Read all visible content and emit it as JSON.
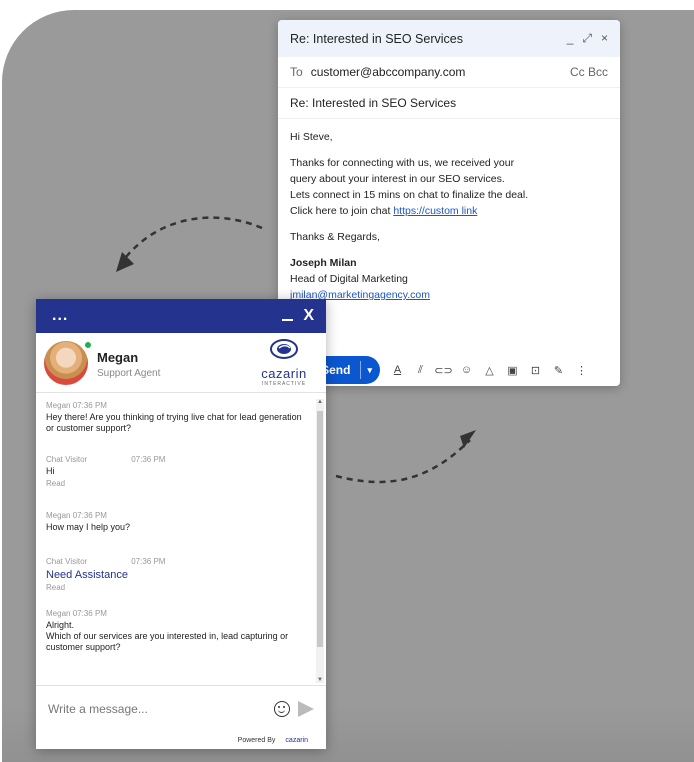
{
  "email": {
    "header_title": "Re: Interested in SEO Services",
    "window_controls": [
      "_",
      "⤢",
      "×"
    ],
    "to_label": "To",
    "to_value": "customer@abccompany.com",
    "cc_bcc": "Cc Bcc",
    "subject": "Re: Interested in SEO Services",
    "greeting": "Hi Steve,",
    "body_lines": [
      "Thanks for connecting with us, we received your",
      "query about your interest in our SEO services.",
      "Lets connect in 15 mins on chat to finalize the deal.",
      "Click here to join chat"
    ],
    "link_text": "https://custom link",
    "closing": "Thanks & Regards,",
    "signature_name": "Joseph Milan",
    "signature_title": "Head of Digital Marketing",
    "signature_email": "jmilan@marketingagency.com",
    "send_label": "Send",
    "toolbar_icons": [
      "format-icon",
      "attach-icon",
      "link-icon",
      "emoji-icon",
      "drive-icon",
      "photo-icon",
      "lock-icon",
      "pen-icon",
      "more-icon"
    ]
  },
  "chat": {
    "menu_dots": "...",
    "close_label": "X",
    "agent_name": "Megan",
    "agent_role": "Support Agent",
    "brand_name": "cazarin",
    "brand_sub": "INTERACTIVE",
    "messages": [
      {
        "sender": "Megan",
        "time": "07:36 PM",
        "text": "Hey there! Are you thinking of trying live chat for lead generation or customer support?",
        "read": ""
      },
      {
        "sender": "Chat Visitor",
        "time": "07:36 PM",
        "text": "Hi",
        "read": "Read"
      },
      {
        "sender": "Megan",
        "time": "07:36 PM",
        "text": "How may I help you?",
        "read": ""
      },
      {
        "sender": "Chat Visitor",
        "time": "07:36 PM",
        "text": "Need Assistance",
        "read": "Read"
      },
      {
        "sender": "Megan",
        "time": "07:36 PM",
        "text": "Alright.\nWhich of our services are you interested in, lead capturing or customer support?",
        "read": ""
      }
    ],
    "input_placeholder": "Write a message...",
    "powered_by": "Powered By",
    "powered_brand": "cazarin"
  },
  "colors": {
    "chat_header": "#24338d",
    "send_button": "#0b57d0",
    "background_panel": "#9a9a9a",
    "online_status": "#22b14c"
  }
}
